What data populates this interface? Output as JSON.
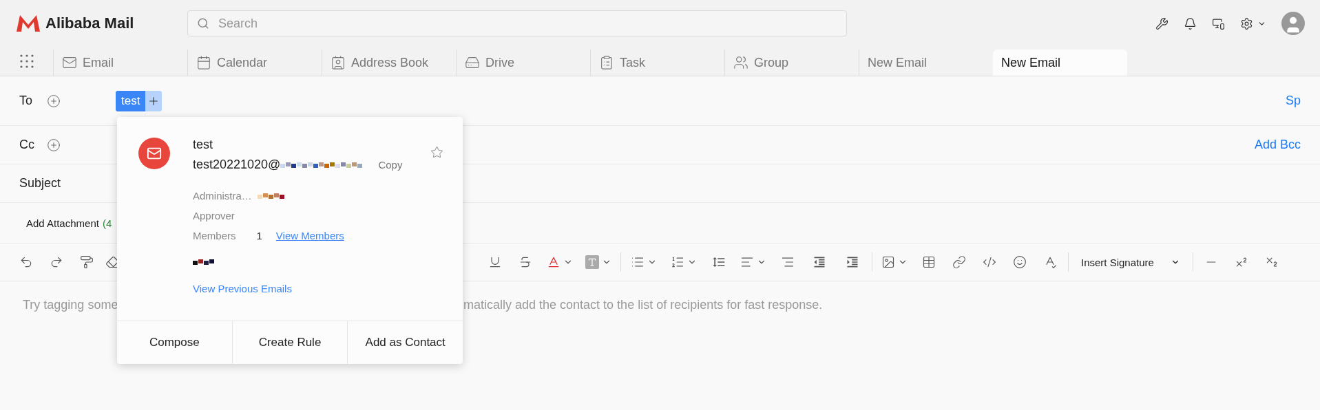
{
  "app": {
    "name": "Alibaba Mail"
  },
  "search": {
    "placeholder": "Search"
  },
  "tabs": [
    {
      "label": "Email",
      "selected": false
    },
    {
      "label": "Calendar",
      "selected": false
    },
    {
      "label": "Address Book",
      "selected": false
    },
    {
      "label": "Drive",
      "selected": false
    },
    {
      "label": "Task",
      "selected": false
    },
    {
      "label": "Group",
      "selected": false
    },
    {
      "label": "New Email",
      "selected": false
    },
    {
      "label": "New Email",
      "selected": true
    }
  ],
  "compose": {
    "to_label": "To",
    "recipient": "test",
    "to_action": "Sp",
    "cc_label": "Cc",
    "cc_action": "Add Bcc",
    "subject_label": "Subject",
    "attachment": "Add Attachment",
    "attachment_note": "(4",
    "signature": "Insert Signature",
    "body_before": "Try tagging some",
    "body_after": "matically add the contact to the list of recipients for fast response."
  },
  "contact_card": {
    "name": "test",
    "email": "test20221020@",
    "copy": "Copy",
    "starred": false,
    "role": "Administra…",
    "approver": "Approver",
    "members_label": "Members",
    "members_count": "1",
    "members_link": "View Members",
    "history_link": "View Previous Emails",
    "actions": [
      "Compose",
      "Create Rule",
      "Add as Contact"
    ]
  }
}
